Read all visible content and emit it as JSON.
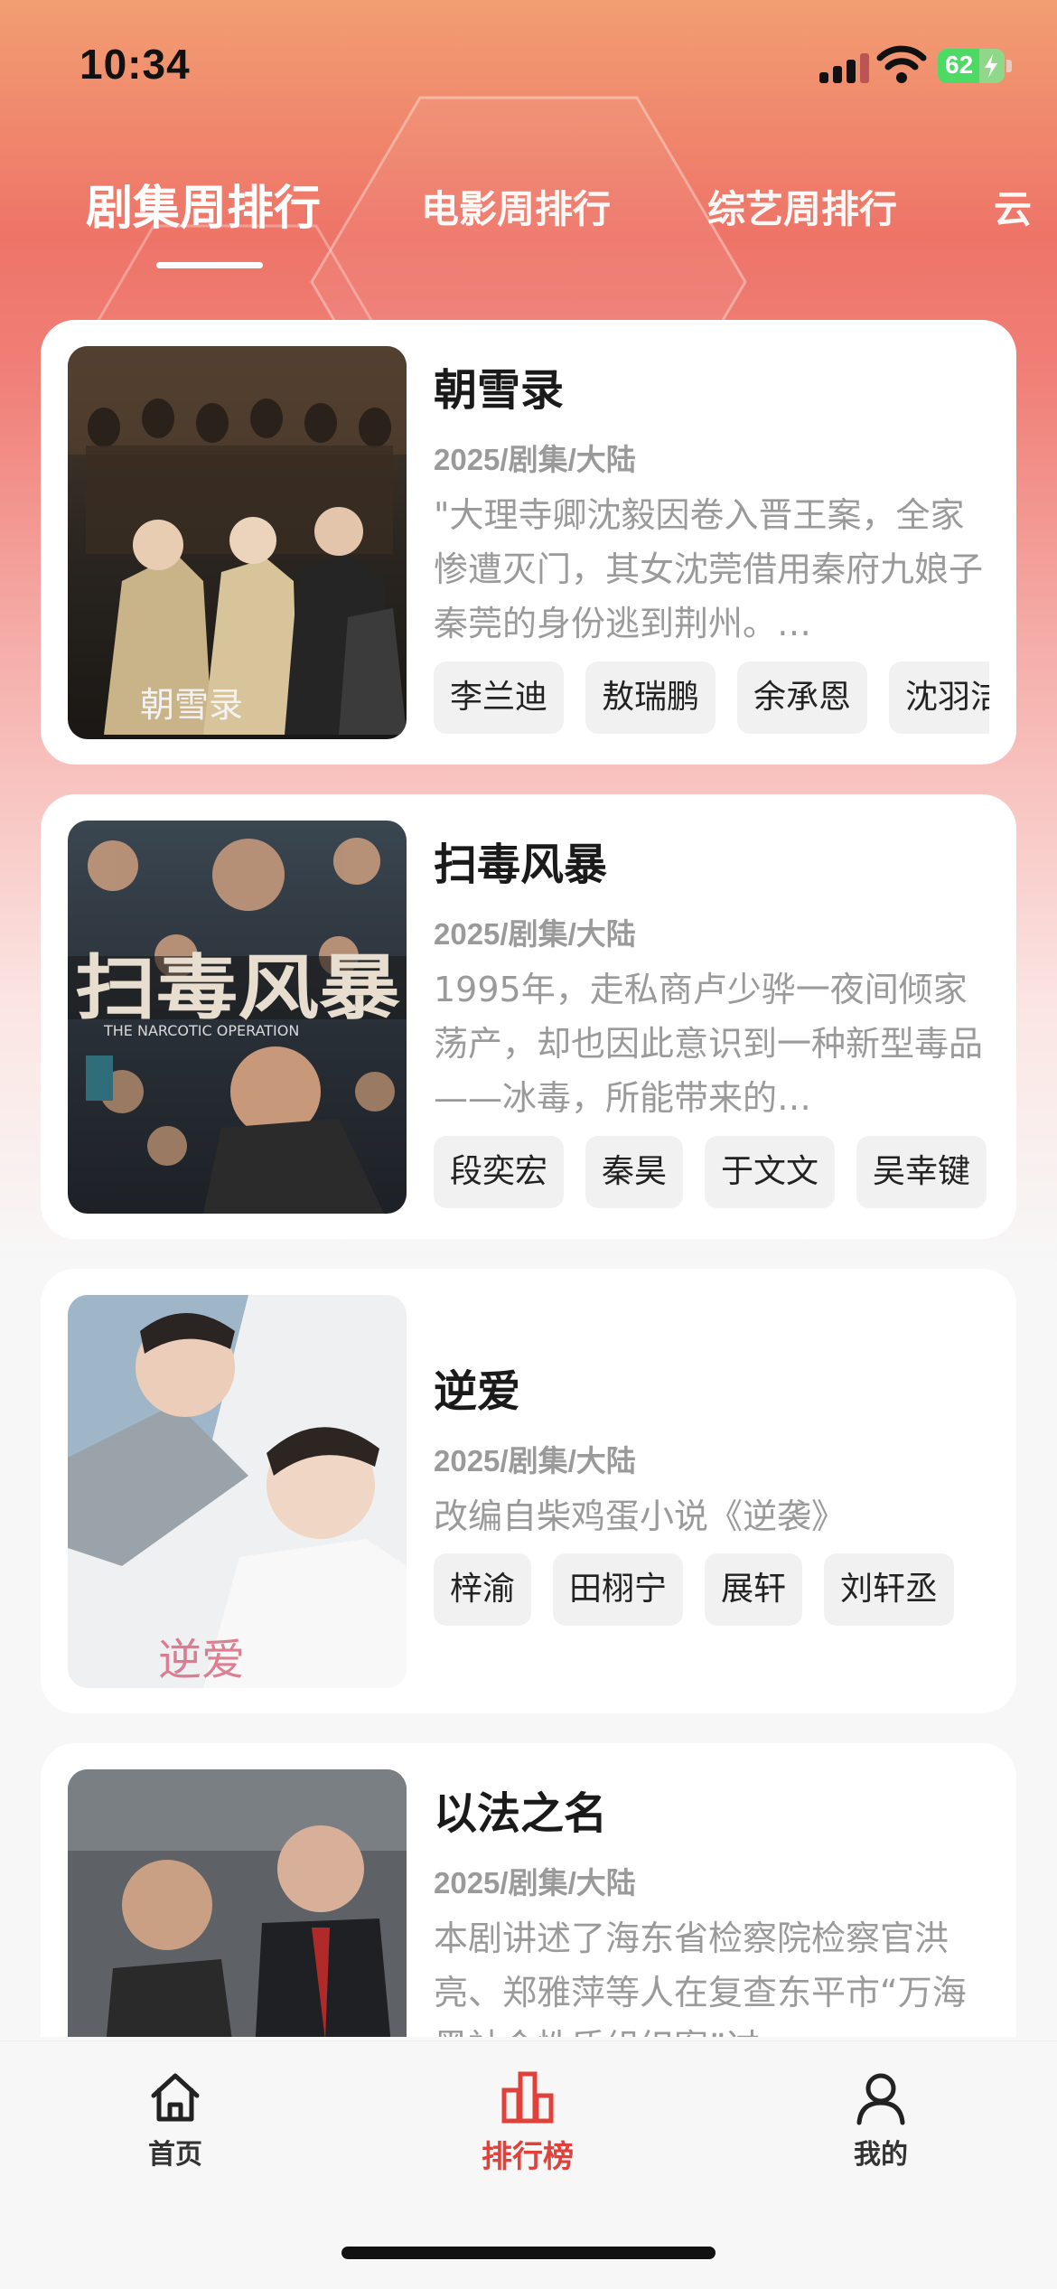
{
  "status_bar": {
    "time": "10:34",
    "battery": "62"
  },
  "tabs": [
    {
      "label": "剧集周排行",
      "active": true
    },
    {
      "label": "电影周排行",
      "active": false
    },
    {
      "label": "综艺周排行",
      "active": false
    },
    {
      "label": "云",
      "active": false
    }
  ],
  "items": [
    {
      "title": "朝雪录",
      "meta": "2025/剧集/大陆",
      "desc": "\"大理寺卿沈毅因卷入晋王案，全家惨遭灭门，其女沈莞借用秦府九娘子秦莞的身份逃到荆州。…",
      "tags": [
        "李兰迪",
        "敖瑞鹏",
        "余承恩",
        "沈羽洁"
      ],
      "poster_text": "朝雪录"
    },
    {
      "title": "扫毒风暴",
      "meta": "2025/剧集/大陆",
      "desc": "1995年，走私商卢少骅一夜间倾家荡产，却也因此意识到一种新型毒品——冰毒，所能带来的…",
      "tags": [
        "段奕宏",
        "秦昊",
        "于文文",
        "吴幸键"
      ],
      "poster_text": "扫毒风暴",
      "poster_subtext": "THE NARCOTIC OPERATION"
    },
    {
      "title": "逆爱",
      "meta": "2025/剧集/大陆",
      "desc": "改编自柴鸡蛋小说《逆袭》",
      "tags": [
        "梓渝",
        "田栩宁",
        "展轩",
        "刘轩丞"
      ],
      "poster_text": "逆爱"
    },
    {
      "title": "以法之名",
      "meta": "2025/剧集/大陆",
      "desc": "本剧讲述了海东省检察院检察官洪亮、郑雅萍等人在复查东平市“万海黑社会性质组织案”过…",
      "tags": [],
      "poster_text": ""
    }
  ],
  "bottom_nav": [
    {
      "label": "首页",
      "icon": "home-icon",
      "active": false
    },
    {
      "label": "排行榜",
      "icon": "bar-chart-icon",
      "active": true
    },
    {
      "label": "我的",
      "icon": "user-icon",
      "active": false
    }
  ],
  "colors": {
    "accent": "#e0413a",
    "header_top": "#f29e72",
    "header_mid": "#ee7468"
  }
}
